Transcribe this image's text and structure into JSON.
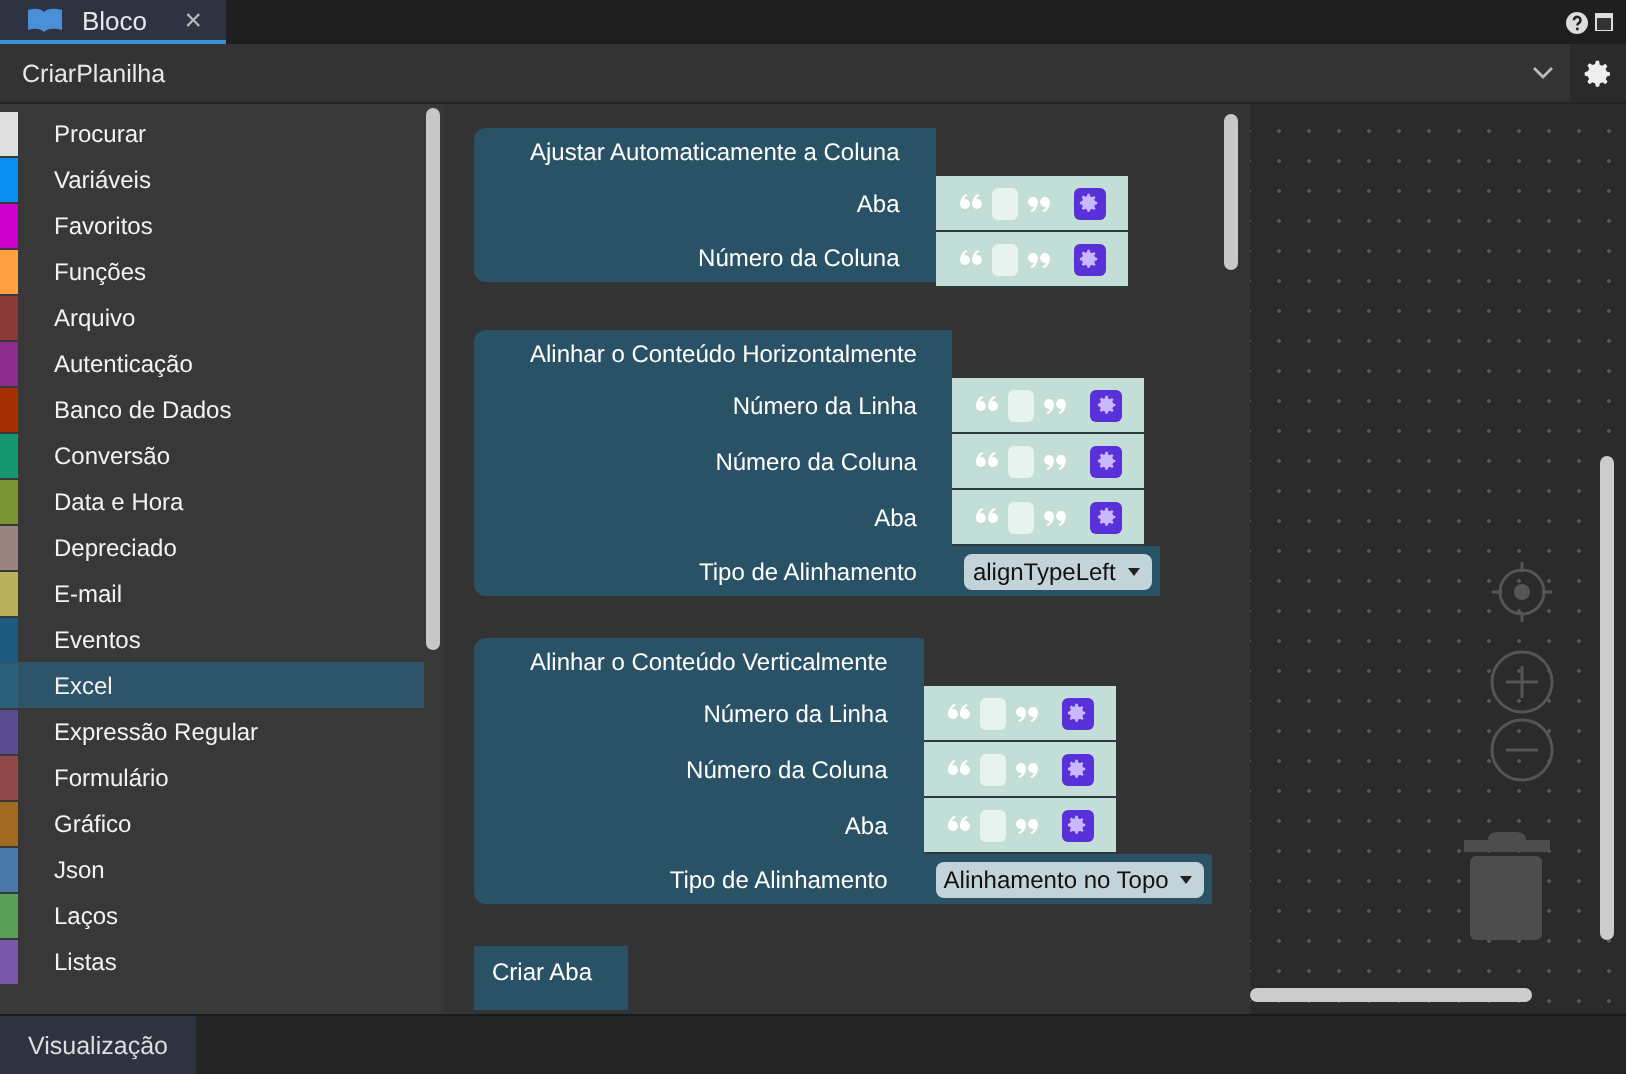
{
  "tab": {
    "label": "Bloco",
    "close": "×",
    "selected": true
  },
  "header": {
    "selector": "CriarPlanilha"
  },
  "sidebar": {
    "items": [
      {
        "label": "Procurar",
        "color": "#e0e0e0",
        "selected": false
      },
      {
        "label": "Variáveis",
        "color": "#0a8ef0",
        "selected": false
      },
      {
        "label": "Favoritos",
        "color": "#cc00cc",
        "selected": false
      },
      {
        "label": "Funções",
        "color": "#ffa040",
        "selected": false
      },
      {
        "label": "Arquivo",
        "color": "#8b3a3a",
        "selected": false
      },
      {
        "label": "Autenticação",
        "color": "#8c2f8c",
        "selected": false
      },
      {
        "label": "Banco de Dados",
        "color": "#a83000",
        "selected": false
      },
      {
        "label": "Conversão",
        "color": "#159870",
        "selected": false
      },
      {
        "label": "Data e Hora",
        "color": "#7a9433",
        "selected": false
      },
      {
        "label": "Depreciado",
        "color": "#9a8482",
        "selected": false
      },
      {
        "label": "E-mail",
        "color": "#b8b05a",
        "selected": false
      },
      {
        "label": "Eventos",
        "color": "#1e5a80",
        "selected": false
      },
      {
        "label": "Excel",
        "color": "#2a6078",
        "selected": true
      },
      {
        "label": "Expressão Regular",
        "color": "#5a4a90",
        "selected": false
      },
      {
        "label": "Formulário",
        "color": "#904848",
        "selected": false
      },
      {
        "label": "Gráfico",
        "color": "#a06a20",
        "selected": false
      },
      {
        "label": "Json",
        "color": "#4a78a8",
        "selected": false
      },
      {
        "label": "Laços",
        "color": "#58a058",
        "selected": false
      },
      {
        "label": "Listas",
        "color": "#7858a8",
        "selected": false
      }
    ]
  },
  "flyout": {
    "blocks": [
      {
        "title": "Ajustar Automaticamente a Coluna",
        "fields": [
          {
            "label": "Aba",
            "kind": "text"
          },
          {
            "label": "Número da Coluna",
            "kind": "text"
          }
        ]
      },
      {
        "title": "Alinhar o Conteúdo Horizontalmente",
        "fields": [
          {
            "label": "Número da Linha",
            "kind": "text"
          },
          {
            "label": "Número da Coluna",
            "kind": "text"
          },
          {
            "label": "Aba",
            "kind": "text"
          },
          {
            "label": "Tipo de Alinhamento",
            "kind": "dropdown",
            "value": "alignTypeLeft"
          }
        ]
      },
      {
        "title": "Alinhar o Conteúdo Verticalmente",
        "fields": [
          {
            "label": "Número da Linha",
            "kind": "text"
          },
          {
            "label": "Número da Coluna",
            "kind": "text"
          },
          {
            "label": "Aba",
            "kind": "text"
          },
          {
            "label": "Tipo de Alinhamento",
            "kind": "dropdown",
            "value": "Alinhamento no Topo"
          }
        ]
      },
      {
        "title": "Criar Aba"
      }
    ]
  },
  "bottom_tab": {
    "label": "Visualização"
  }
}
